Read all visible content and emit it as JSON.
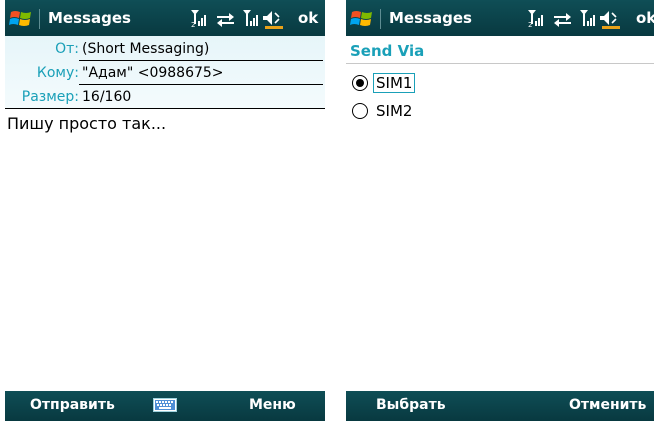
{
  "left_screen": {
    "title": "Messages",
    "ok_label": "ok",
    "fields": {
      "from_label": "От:",
      "from_value": "(Short Messaging)",
      "to_label": "Кому:",
      "to_value": "\"Адам\" <0988675>",
      "size_label": "Размер:",
      "size_value": "16/160"
    },
    "body_text": "Пишу просто так...",
    "softkeys": {
      "left": "Отправить",
      "right": "Меню"
    }
  },
  "right_screen": {
    "title": "Messages",
    "ok_label": "ok",
    "section_title": "Send Via",
    "options": [
      {
        "label": "SIM1",
        "checked": true
      },
      {
        "label": "SIM2",
        "checked": false
      }
    ],
    "softkeys": {
      "left": "Выбрать",
      "right": "Отменить"
    }
  },
  "icons": [
    "windows-start-icon",
    "signal-sim2-icon",
    "data-transfer-icon",
    "signal-sim1-icon",
    "volume-icon",
    "keyboard-icon"
  ],
  "colors": {
    "titlebar": "#0f4e56",
    "accent": "#1aa0b8"
  }
}
